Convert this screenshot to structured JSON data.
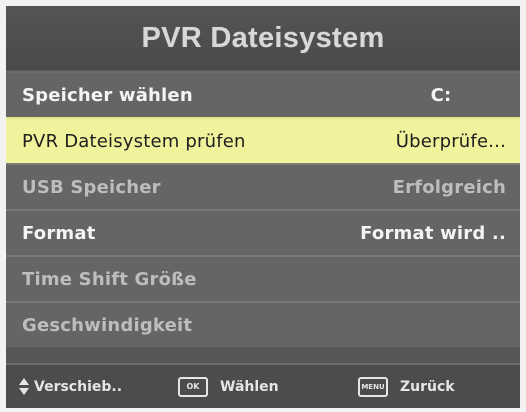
{
  "header": {
    "title": "PVR Dateisystem"
  },
  "rows": [
    {
      "label": "Speicher wählen",
      "value": "C:",
      "state": "bright"
    },
    {
      "label": "PVR Dateisystem prüfen",
      "value": "Überprüfe...",
      "state": "selected"
    },
    {
      "label": "USB Speicher",
      "value": "Erfolgreich",
      "state": "dim"
    },
    {
      "label": "Format",
      "value": "Format wird ..",
      "state": "bright"
    },
    {
      "label": "Time Shift Größe",
      "value": "",
      "state": "dim"
    },
    {
      "label": "Geschwindigkeit",
      "value": "",
      "state": "dim"
    }
  ],
  "footer": {
    "move_label": "Verschieb..",
    "move_icon": "up-down-arrows-icon",
    "ok_key": "OK",
    "ok_label": "Wählen",
    "menu_key": "MENU",
    "menu_label": "Zurück"
  },
  "colors": {
    "panel_bg": "#565656",
    "row_bg": "#656565",
    "highlight_bg": "#f0f29c",
    "header_bg": "#4a4a4a",
    "footer_bg": "#4c4c4c"
  }
}
